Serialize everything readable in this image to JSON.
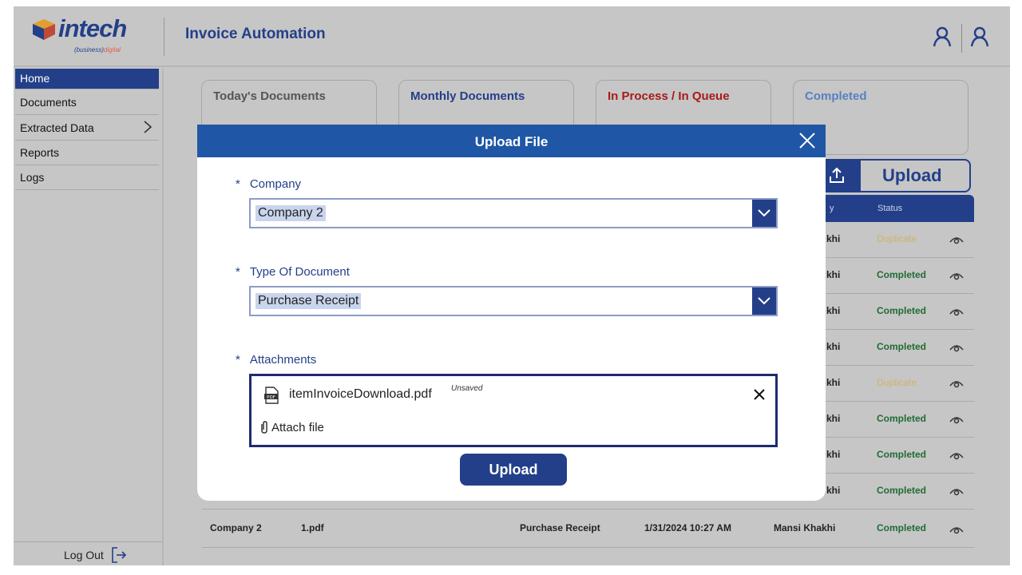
{
  "header": {
    "logo_word": "intech",
    "logo_sub_business": "(business)",
    "logo_sub_digital": "digital",
    "app_title": "Invoice Automation",
    "user_icon": "user-outline-icon",
    "profile_icon": "user-outline-icon"
  },
  "sidebar": {
    "items": [
      {
        "label": "Home",
        "active": true
      },
      {
        "label": "Documents"
      },
      {
        "label": "Extracted Data",
        "has_submenu": true
      },
      {
        "label": "Reports"
      },
      {
        "label": "Logs"
      }
    ],
    "logout_label": "Log Out"
  },
  "cards": [
    {
      "title": "Today's Documents",
      "color": "#555555"
    },
    {
      "title": "Monthly Documents",
      "color": "#233f89"
    },
    {
      "title": "In Process / In Queue",
      "color": "#a81a1a"
    },
    {
      "title": "Completed",
      "color": "#5a7fc1"
    }
  ],
  "upload_button": {
    "label": "Upload",
    "icon": "upload-icon"
  },
  "table": {
    "headers": {
      "uploaded_by_partial": "y",
      "status": "Status"
    },
    "partial_rows": [
      {
        "by": "khi",
        "status": "Duplicate"
      },
      {
        "by": "khi",
        "status": "Completed"
      },
      {
        "by": "khi",
        "status": "Completed"
      },
      {
        "by": "khi",
        "status": "Completed"
      },
      {
        "by": "khi",
        "status": "Duplicate"
      },
      {
        "by": "khi",
        "status": "Completed"
      },
      {
        "by": "khi",
        "status": "Completed"
      },
      {
        "by": "khi",
        "status": "Completed"
      }
    ],
    "last_row": {
      "company": "Company 2",
      "file": "1.pdf",
      "doc_type": "Purchase Receipt",
      "datetime": "1/31/2024 10:27 AM",
      "uploaded_by": "Mansi Khakhi",
      "status": "Completed"
    }
  },
  "modal": {
    "title": "Upload File",
    "required_mark": "*",
    "company_label": "Company",
    "company_value": "Company 2",
    "doctype_label": "Type Of Document",
    "doctype_value": "Purchase Receipt",
    "attachments_label": "Attachments",
    "attachment_file": "itemInvoiceDownload.pdf",
    "attachment_state": "Unsaved",
    "attach_link": "Attach file",
    "upload_label": "Upload"
  },
  "colors": {
    "primary": "#233f89",
    "modal_header": "#1f57a6",
    "completed": "#1f6c34",
    "duplicate": "#cdb36a",
    "overlay_bg": "#c6c6c6"
  }
}
